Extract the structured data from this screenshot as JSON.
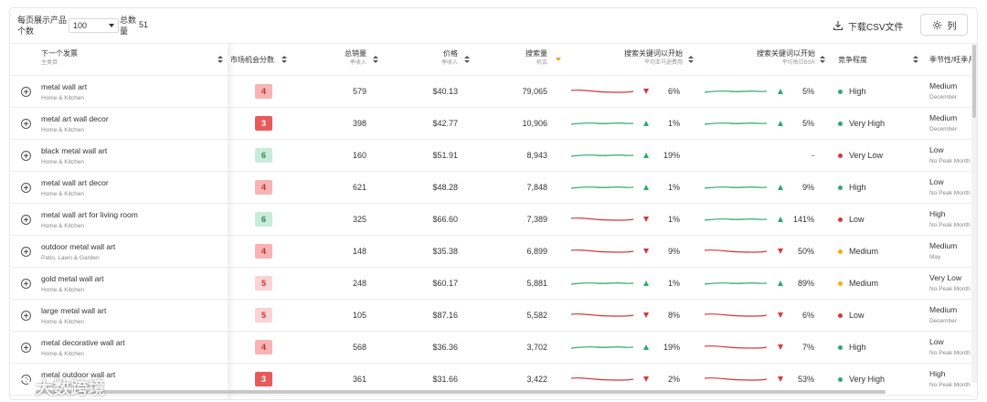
{
  "toolbar": {
    "per_page_label": "每页展示产品个数",
    "per_page_value": "100",
    "total_label": "总数量",
    "total_value": "51",
    "download_label": "下载CSV文件",
    "columns_label": "列"
  },
  "headers": {
    "keyword": "下一个发票",
    "keyword_sub": "主类目",
    "score": "市场机会分数",
    "sales": "总销量",
    "sales_sub": "季收入",
    "price": "价格",
    "price_sub": "季收入",
    "search": "搜索量",
    "search_sub": "机会",
    "trend1": "搜索关键词以开始",
    "trend1_sub": "平均亚马逊费用",
    "trend2": "搜索关键词以开始",
    "trend2_sub": "平均每日BSR",
    "competition": "竞争程度",
    "season": "季节性/旺季月"
  },
  "colors": {
    "up": "#2eaa6b",
    "down": "#d9363e",
    "high": "#2eaa6b",
    "medium": "#e8b80e",
    "low": "#d9363e"
  },
  "rows": [
    {
      "keyword": "metal wall art",
      "category": "Home & Kitchen",
      "score": "4",
      "score_level": "red",
      "sales": "579",
      "price": "$40.13",
      "search": "79,065",
      "t1_dir": "down",
      "t1_pct": "6%",
      "t2_dir": "up",
      "t2_pct": "5%",
      "comp": "High",
      "comp_level": "high",
      "season": "Medium",
      "season_sub": "December"
    },
    {
      "keyword": "metal art wall decor",
      "category": "Home & Kitchen",
      "score": "3",
      "score_level": "darkred",
      "sales": "398",
      "price": "$42.77",
      "search": "10,906",
      "t1_dir": "up",
      "t1_pct": "1%",
      "t2_dir": "up",
      "t2_pct": "5%",
      "comp": "Very High",
      "comp_level": "high",
      "season": "Medium",
      "season_sub": "December"
    },
    {
      "keyword": "black metal wall art",
      "category": "Home & Kitchen",
      "score": "6",
      "score_level": "green",
      "sales": "160",
      "price": "$51.91",
      "search": "8,943",
      "t1_dir": "up",
      "t1_pct": "19%",
      "t2_dir": "none",
      "t2_pct": "-",
      "comp": "Very Low",
      "comp_level": "low",
      "season": "Low",
      "season_sub": "No Peak Month"
    },
    {
      "keyword": "metal wall art decor",
      "category": "Home & Kitchen",
      "score": "4",
      "score_level": "red",
      "sales": "621",
      "price": "$48.28",
      "search": "7,848",
      "t1_dir": "up",
      "t1_pct": "1%",
      "t2_dir": "up",
      "t2_pct": "9%",
      "comp": "High",
      "comp_level": "high",
      "season": "Low",
      "season_sub": "No Peak Month"
    },
    {
      "keyword": "metal wall art for living room",
      "category": "Home & Kitchen",
      "score": "6",
      "score_level": "green",
      "sales": "325",
      "price": "$66.60",
      "search": "7,389",
      "t1_dir": "down",
      "t1_pct": "1%",
      "t2_dir": "up",
      "t2_pct": "141%",
      "comp": "Low",
      "comp_level": "low",
      "season": "High",
      "season_sub": "No Peak Month"
    },
    {
      "keyword": "outdoor metal wall art",
      "category": "Patio, Lawn & Garden",
      "score": "4",
      "score_level": "red",
      "sales": "148",
      "price": "$35.38",
      "search": "6,899",
      "t1_dir": "down",
      "t1_pct": "9%",
      "t2_dir": "down",
      "t2_pct": "50%",
      "comp": "Medium",
      "comp_level": "medium",
      "season": "Medium",
      "season_sub": "May"
    },
    {
      "keyword": "gold metal wall art",
      "category": "Home & Kitchen",
      "score": "5",
      "score_level": "pink",
      "sales": "248",
      "price": "$60.17",
      "search": "5,881",
      "t1_dir": "up",
      "t1_pct": "1%",
      "t2_dir": "up",
      "t2_pct": "89%",
      "comp": "Medium",
      "comp_level": "medium",
      "season": "Very Low",
      "season_sub": "No Peak Month"
    },
    {
      "keyword": "large metal wall art",
      "category": "Home & Kitchen",
      "score": "5",
      "score_level": "pink",
      "sales": "105",
      "price": "$87.16",
      "search": "5,582",
      "t1_dir": "down",
      "t1_pct": "8%",
      "t2_dir": "down",
      "t2_pct": "6%",
      "comp": "Low",
      "comp_level": "low",
      "season": "Medium",
      "season_sub": "December"
    },
    {
      "keyword": "metal decorative wall art",
      "category": "Home & Kitchen",
      "score": "4",
      "score_level": "red",
      "sales": "568",
      "price": "$36.36",
      "search": "3,702",
      "t1_dir": "up",
      "t1_pct": "19%",
      "t2_dir": "down",
      "t2_pct": "7%",
      "comp": "High",
      "comp_level": "high",
      "season": "Low",
      "season_sub": "No Peak Month"
    },
    {
      "keyword": "metal outdoor wall art",
      "category": "Patio, Lawn & Garden",
      "score": "3",
      "score_level": "darkred",
      "sales": "361",
      "price": "$31.66",
      "search": "3,422",
      "t1_dir": "down",
      "t1_pct": "2%",
      "t2_dir": "down",
      "t2_pct": "53%",
      "comp": "Very High",
      "comp_level": "high",
      "season": "High",
      "season_sub": "No Peak Month"
    }
  ],
  "watermark": "大数跨境"
}
